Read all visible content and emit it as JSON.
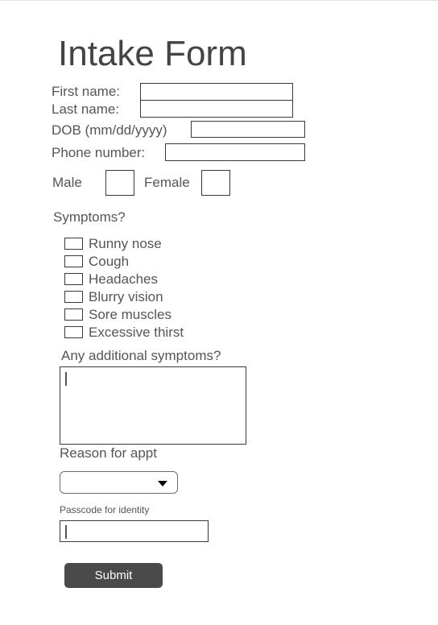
{
  "form": {
    "title": "Intake Form",
    "fields": {
      "first_name": {
        "label": "First name:",
        "value": "",
        "placeholder": ""
      },
      "last_name": {
        "label": "Last name:",
        "value": "",
        "placeholder": ""
      },
      "dob": {
        "label": "DOB (mm/dd/yyyy)",
        "value": "",
        "placeholder": ""
      },
      "phone": {
        "label": "Phone number:",
        "value": "",
        "placeholder": ""
      }
    },
    "gender": {
      "male_label": "Male",
      "female_label": "Female",
      "male_checked": false,
      "female_checked": false
    },
    "symptoms": {
      "heading": "Symptoms?",
      "options": [
        {
          "label": "Runny nose",
          "checked": false
        },
        {
          "label": "Cough",
          "checked": false
        },
        {
          "label": "Headaches",
          "checked": false
        },
        {
          "label": "Blurry vision",
          "checked": false
        },
        {
          "label": "Sore muscles",
          "checked": false
        },
        {
          "label": "Excessive thirst",
          "checked": false
        }
      ]
    },
    "additional_symptoms": {
      "label": "Any additional symptoms?",
      "value": "",
      "placeholder": "",
      "focused": true
    },
    "reason": {
      "label": "Reason for appt",
      "selected": "",
      "placeholder": "",
      "arrow_icon": "chevron-down-icon"
    },
    "passcode": {
      "label": "Passcode for identity",
      "value": "",
      "placeholder": "",
      "focused": true
    },
    "submit": {
      "label": "Submit"
    }
  },
  "colors": {
    "page_background": "#ffffff",
    "text": "#555555",
    "title_text": "#444444",
    "field_border": "#3a3a3a",
    "select_border": "#6d6d6d",
    "button_background": "#4a4a4a",
    "button_text": "#ffffff",
    "top_rule": "#e2e2e2"
  }
}
